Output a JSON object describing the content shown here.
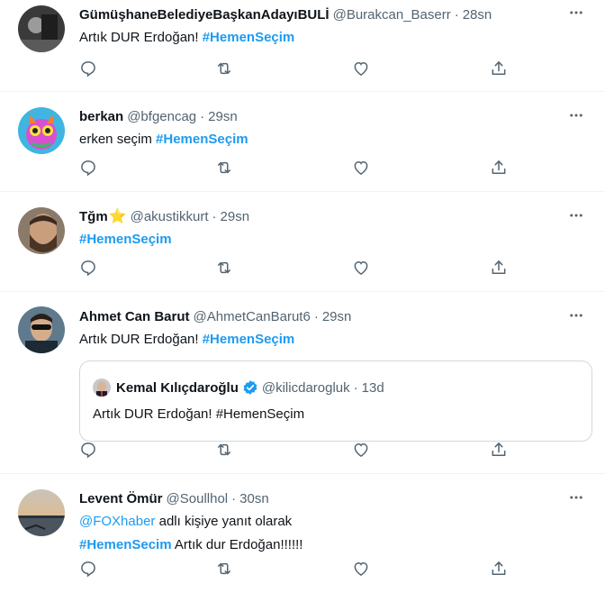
{
  "tweets": [
    {
      "name": "GümüşhaneBelediyeBaşkanAdayıBULİ",
      "handle": "@Burakcan_Baserr",
      "time": "28sn",
      "text_plain": "Artık DUR Erdoğan! ",
      "hashtag": "#HemenSeçim",
      "avatar_icon": "dark-photo-avatar"
    },
    {
      "name": "berkan",
      "handle": "@bfgencag",
      "time": "29sn",
      "text_plain": "erken seçim ",
      "hashtag": "#HemenSeçim",
      "avatar_icon": "colorful-cartoon-avatar"
    },
    {
      "name": "Tğm",
      "name_emoji": "⭐",
      "handle": "@akustikkurt",
      "time": "29sn",
      "hashtag": "#HemenSeçim",
      "avatar_icon": "bearded-man-avatar"
    },
    {
      "name": "Ahmet Can Barut",
      "handle": "@AhmetCanBarut6",
      "time": "29sn",
      "text_plain": "Artık DUR Erdoğan! ",
      "hashtag": "#HemenSeçim",
      "avatar_icon": "man-sunglasses-avatar",
      "quote": {
        "name": "Kemal Kılıçdaroğlu",
        "handle": "@kilicdarogluk",
        "time": "13d",
        "text": "Artık DUR Erdoğan! #HemenSeçim"
      }
    },
    {
      "name": "Levent Ömür",
      "handle": "@Soullhol",
      "time": "30sn",
      "reply_mention": "@FOXhaber",
      "reply_rest": " adlı kişiye yanıt olarak",
      "hashtag": "#HemenSecim",
      "text_after": " Artık dur Erdoğan!!!!!!",
      "avatar_icon": "sunset-sea-avatar"
    }
  ],
  "separator": "·",
  "colors": {
    "link": "#1d9bf0",
    "secondary": "#536471",
    "border": "#eff3f4",
    "verified": "#1d9bf0"
  },
  "action_icons": [
    "reply-icon",
    "retweet-icon",
    "like-icon",
    "share-icon"
  ]
}
